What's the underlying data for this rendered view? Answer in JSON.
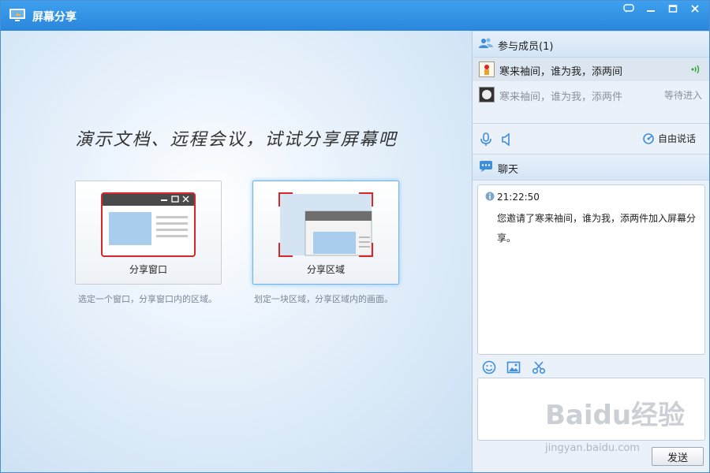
{
  "window": {
    "title": "屏幕分享"
  },
  "main": {
    "headline": "演示文档、远程会议，试试分享屏幕吧",
    "options": [
      {
        "label": "分享窗口",
        "desc": "选定一个窗口，分享窗口内的区域。"
      },
      {
        "label": "分享区域",
        "desc": "划定一块区域，分享区域内的画面。"
      }
    ]
  },
  "members": {
    "header": "参与成员(1)",
    "list": [
      {
        "name": "寒来袖间，谁为我，添两间",
        "status": ""
      },
      {
        "name": "寒来袖间，谁为我，添两件",
        "status": "等待进入"
      }
    ]
  },
  "voice": {
    "free_talk": "自由说话"
  },
  "chat": {
    "header": "聊天",
    "messages": [
      {
        "time": "21:22:50",
        "text": "您邀请了寒来袖间，谁为我，添两件加入屏幕分享。"
      }
    ],
    "send_label": "发送"
  },
  "watermark": {
    "brand": "Baidu经验",
    "url": "jingyan.baidu.com"
  },
  "colors": {
    "titlebar": "#2a86dc",
    "accent": "#2f87d8",
    "share_border": "#d8262a"
  }
}
